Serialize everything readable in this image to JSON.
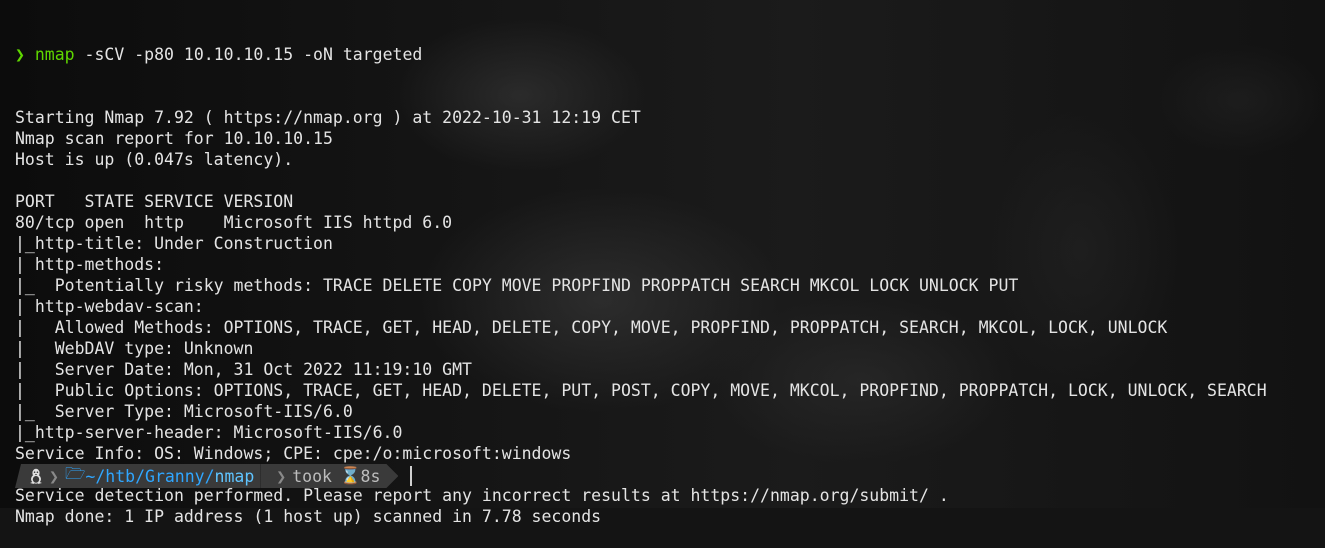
{
  "terminal": {
    "prompt_symbol": "❯",
    "command_name": "nmap",
    "command_args": " -sCV -p80 10.10.10.15 -oN targeted",
    "output_lines": [
      "Starting Nmap 7.92 ( https://nmap.org ) at 2022-10-31 12:19 CET",
      "Nmap scan report for 10.10.10.15",
      "Host is up (0.047s latency).",
      "",
      "PORT   STATE SERVICE VERSION",
      "80/tcp open  http    Microsoft IIS httpd 6.0",
      "|_http-title: Under Construction",
      "| http-methods:",
      "|_  Potentially risky methods: TRACE DELETE COPY MOVE PROPFIND PROPPATCH SEARCH MKCOL LOCK UNLOCK PUT",
      "| http-webdav-scan:",
      "|   Allowed Methods: OPTIONS, TRACE, GET, HEAD, DELETE, COPY, MOVE, PROPFIND, PROPPATCH, SEARCH, MKCOL, LOCK, UNLOCK",
      "|   WebDAV type: Unknown",
      "|   Server Date: Mon, 31 Oct 2022 11:19:10 GMT",
      "|   Public Options: OPTIONS, TRACE, GET, HEAD, DELETE, PUT, POST, COPY, MOVE, MKCOL, PROPFIND, PROPPATCH, LOCK, UNLOCK, SEARCH",
      "|_  Server Type: Microsoft-IIS/6.0",
      "|_http-server-header: Microsoft-IIS/6.0",
      "Service Info: OS: Windows; CPE: cpe:/o:microsoft:windows",
      "",
      "Service detection performed. Please report any incorrect results at https://nmap.org/submit/ .",
      "Nmap done: 1 IP address (1 host up) scanned in 7.78 seconds"
    ]
  },
  "statusbar": {
    "os_icon": "tux-icon",
    "folder_icon": "folder-open-icon",
    "path_prefix": "~/htb/Granny/",
    "path_current": "nmap",
    "took_label": "took",
    "hourglass_icon": "⌛",
    "duration": "8s"
  },
  "colors": {
    "command": "#5fd700",
    "path": "#2fa6ff",
    "statusbar_bg": "#3a3a3a",
    "text": "#e4e4e4"
  }
}
